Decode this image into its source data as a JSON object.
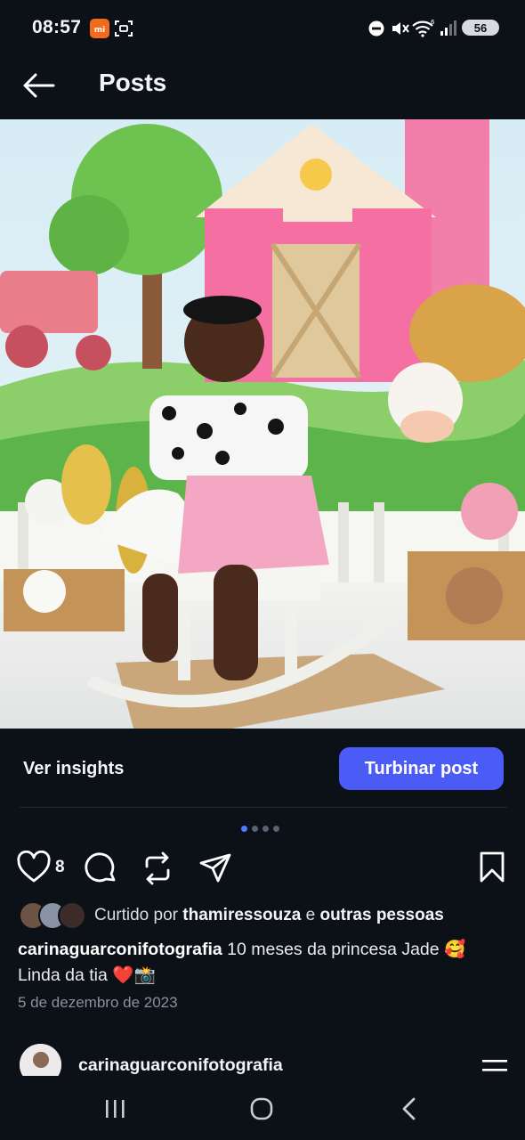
{
  "status_bar": {
    "time": "08:57",
    "battery": "56"
  },
  "header": {
    "title": "Posts"
  },
  "post": {
    "insights_label": "Ver insights",
    "boost_label": "Turbinar post",
    "carousel": {
      "count": 4,
      "active": 1
    },
    "likes_count": "8",
    "liked_by_prefix": "Curtido por",
    "liked_by_user": "thamiressouza",
    "liked_by_connector": "e",
    "liked_by_others": "outras pessoas",
    "caption_user": "carinaguarconifotografia",
    "caption_text_line1": "10 meses da princesa Jade 🥰",
    "caption_text_line2": "Linda da tia ❤️📸",
    "date": "5 de dezembro de 2023"
  },
  "next_post": {
    "username": "carinaguarconifotografia"
  },
  "colors": {
    "background": "#0c1017",
    "accent": "#4a5cf5",
    "active_dot": "#4a7cff"
  }
}
